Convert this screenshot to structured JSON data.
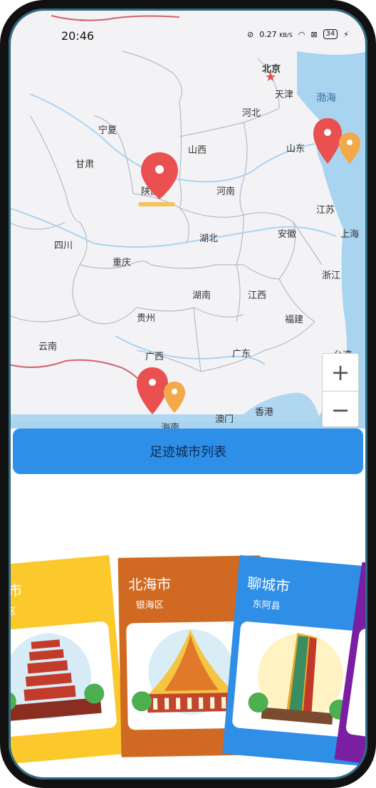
{
  "status_bar": {
    "time": "20:46",
    "net_speed": "0.27",
    "net_unit": "KB/S",
    "battery": "34"
  },
  "map": {
    "provinces": [
      "宁夏",
      "甘肃",
      "陕西",
      "山西",
      "河北",
      "北京",
      "天津",
      "山东",
      "河南",
      "江苏",
      "上海",
      "安徽",
      "湖北",
      "四川",
      "重庆",
      "浙江",
      "湖南",
      "江西",
      "贵州",
      "福建",
      "云南",
      "广西",
      "广东",
      "台湾",
      "澳门",
      "香港",
      "海南"
    ],
    "seas": [
      "渤海"
    ],
    "zoom_in": "+",
    "zoom_out": "−",
    "colors": {
      "land": "#f3f3f6",
      "water": "#a8d4f0",
      "border": "#b8b8c8",
      "pin_red": "#e9504f",
      "pin_orange": "#f3a94a"
    }
  },
  "footprint_button": {
    "label": "足迹城市列表",
    "color": "#2e8fe8"
  },
  "cards": [
    {
      "city": "西安市",
      "district": "未央区",
      "color": "#fbc92c",
      "icon": "pagoda-icon"
    },
    {
      "city": "北海市",
      "district": "银海区",
      "color": "#d06a22",
      "icon": "pavilion-icon"
    },
    {
      "city": "聊城市",
      "district": "东阿县",
      "color": "#2f8ee6",
      "icon": "tower-icon"
    },
    {
      "city": "",
      "district": "",
      "color": "#7b1fa2",
      "icon": "building-icon"
    }
  ]
}
